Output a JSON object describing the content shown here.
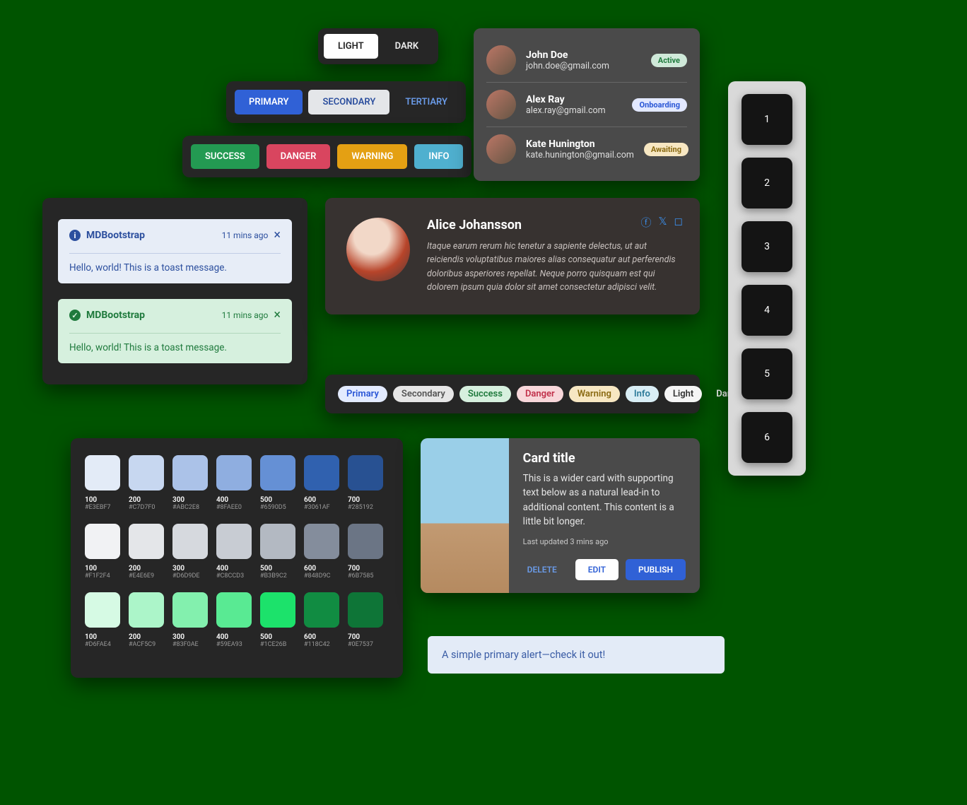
{
  "theme_toggle": {
    "light": "LIGHT",
    "dark": "DARK"
  },
  "button_row1": {
    "primary": "PRIMARY",
    "secondary": "SECONDARY",
    "tertiary": "TERTIARY"
  },
  "button_row2": {
    "success": "SUCCESS",
    "danger": "DANGER",
    "warning": "WARNING",
    "info": "INFO"
  },
  "users": [
    {
      "name": "John Doe",
      "email": "john.doe@gmail.com",
      "badge": "Active",
      "badge_bg": "#cfe9d9",
      "badge_fg": "#1f7a3d"
    },
    {
      "name": "Alex Ray",
      "email": "alex.ray@gmail.com",
      "badge": "Onboarding",
      "badge_bg": "#e2e8ff",
      "badge_fg": "#2a56d6"
    },
    {
      "name": "Kate Hunington",
      "email": "kate.hunington@gmail.com",
      "badge": "Awaiting",
      "badge_bg": "#f7e7c2",
      "badge_fg": "#8a6a12"
    }
  ],
  "toasts": [
    {
      "title": "MDBootstrap",
      "time": "11 mins ago",
      "body": "Hello, world! This is a toast message.",
      "bg": "#e7edf7",
      "fg": "#2c4f9e"
    },
    {
      "title": "MDBootstrap",
      "time": "11 mins ago",
      "body": "Hello, world! This is a toast message.",
      "bg": "#d6f0de",
      "fg": "#1f7a3d"
    }
  ],
  "profile": {
    "name": "Alice Johansson",
    "bio": "Itaque earum rerum hic tenetur a sapiente delectus, ut aut reiciendis voluptatibus maiores alias consequatur aut perferendis doloribus asperiores repellat. Neque porro quisquam est qui dolorem ipsum quia dolor sit amet consectetur adipisci velit."
  },
  "pills": [
    {
      "label": "Primary",
      "bg": "#e3ebff",
      "fg": "#2a56d6"
    },
    {
      "label": "Secondary",
      "bg": "#e6e6e6",
      "fg": "#555"
    },
    {
      "label": "Success",
      "bg": "#d6f0de",
      "fg": "#1f7a3d"
    },
    {
      "label": "Danger",
      "bg": "#f8d7da",
      "fg": "#c1304a"
    },
    {
      "label": "Warning",
      "bg": "#f7e7c2",
      "fg": "#8a6a12"
    },
    {
      "label": "Info",
      "bg": "#d9eef5",
      "fg": "#2b7a99"
    },
    {
      "label": "Light",
      "bg": "#f5f5f5",
      "fg": "#333"
    },
    {
      "label": "Dark",
      "bg": "transparent",
      "fg": "#eee"
    }
  ],
  "palette": [
    [
      {
        "n": "100",
        "hex": "#E3EBF7"
      },
      {
        "n": "200",
        "hex": "#C7D7F0"
      },
      {
        "n": "300",
        "hex": "#ABC2E8"
      },
      {
        "n": "400",
        "hex": "#8FAEE0"
      },
      {
        "n": "500",
        "hex": "#6590D5"
      },
      {
        "n": "600",
        "hex": "#3061AF"
      },
      {
        "n": "700",
        "hex": "#285192"
      }
    ],
    [
      {
        "n": "100",
        "hex": "#F1F2F4"
      },
      {
        "n": "200",
        "hex": "#E4E6E9"
      },
      {
        "n": "300",
        "hex": "#D6D9DE"
      },
      {
        "n": "400",
        "hex": "#C8CCD3"
      },
      {
        "n": "500",
        "hex": "#B3B9C2"
      },
      {
        "n": "600",
        "hex": "#848D9C"
      },
      {
        "n": "700",
        "hex": "#6B7585"
      }
    ],
    [
      {
        "n": "100",
        "hex": "#D6FAE4"
      },
      {
        "n": "200",
        "hex": "#ACF5C9"
      },
      {
        "n": "300",
        "hex": "#83F0AE"
      },
      {
        "n": "400",
        "hex": "#59EA93"
      },
      {
        "n": "500",
        "hex": "#1CE26B"
      },
      {
        "n": "600",
        "hex": "#118C42"
      },
      {
        "n": "700",
        "hex": "#0E7537"
      }
    ]
  ],
  "card": {
    "title": "Card title",
    "body": "This is a wider card with supporting text below as a natural lead-in to additional content. This content is a little bit longer.",
    "updated": "Last updated 3 mins ago",
    "delete": "DELETE",
    "edit": "EDIT",
    "publish": "PUBLISH"
  },
  "alert": {
    "text": "A simple primary alert—check it out!"
  },
  "numbers": [
    "1",
    "2",
    "3",
    "4",
    "5",
    "6"
  ]
}
